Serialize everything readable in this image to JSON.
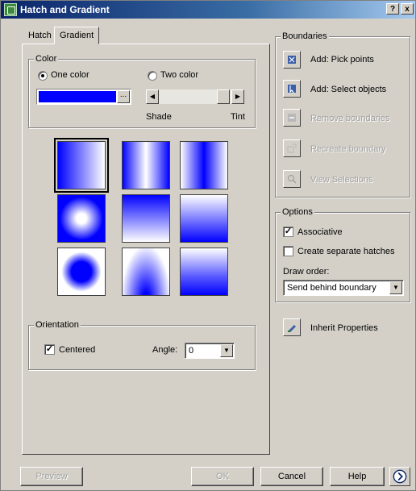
{
  "window": {
    "title": "Hatch and Gradient",
    "help_btn": "?",
    "close_btn": "x"
  },
  "tabs": [
    {
      "label": "Hatch"
    },
    {
      "label": "Gradient"
    }
  ],
  "color": {
    "group_label": "Color",
    "one_color_label": "One color",
    "two_color_label": "Two color",
    "selected_mode": "one",
    "swatch_color": "#0000ff",
    "swatch_button": "...",
    "shade_label": "Shade",
    "tint_label": "Tint",
    "shade_tint_value": 1.0
  },
  "gradient_patterns": [
    {
      "name": "linear",
      "selected": true
    },
    {
      "name": "cylinder",
      "selected": false
    },
    {
      "name": "invcylinder",
      "selected": false
    },
    {
      "name": "spherical",
      "selected": false
    },
    {
      "name": "hemispherical",
      "selected": false
    },
    {
      "name": "curved",
      "selected": false
    },
    {
      "name": "invspherical",
      "selected": false
    },
    {
      "name": "invhemispherical",
      "selected": false
    },
    {
      "name": "invcurved",
      "selected": false
    }
  ],
  "orientation": {
    "group_label": "Orientation",
    "centered_label": "Centered",
    "centered_checked": true,
    "angle_label": "Angle:",
    "angle_value": "0"
  },
  "boundaries": {
    "group_label": "Boundaries",
    "items": [
      {
        "label": "Add: Pick points",
        "enabled": true,
        "icon": "pick-points-icon"
      },
      {
        "label": "Add: Select objects",
        "enabled": true,
        "icon": "select-objects-icon"
      },
      {
        "label": "Remove boundaries",
        "enabled": false,
        "icon": "remove-boundaries-icon"
      },
      {
        "label": "Recreate boundary",
        "enabled": false,
        "icon": "recreate-boundary-icon"
      },
      {
        "label": "View Selections",
        "enabled": false,
        "icon": "view-selections-icon"
      }
    ]
  },
  "options": {
    "group_label": "Options",
    "associative_label": "Associative",
    "associative_checked": true,
    "separate_label": "Create separate hatches",
    "separate_checked": false,
    "draw_order_label": "Draw order:",
    "draw_order_value": "Send behind boundary"
  },
  "inherit": {
    "label": "Inherit Properties"
  },
  "footer": {
    "preview": "Preview",
    "ok": "OK",
    "cancel": "Cancel",
    "help": "Help"
  },
  "colors": {
    "gradient_blue": "#0000ff",
    "title_dark": "#0a246a",
    "dialog_face": "#d4d0c8"
  }
}
